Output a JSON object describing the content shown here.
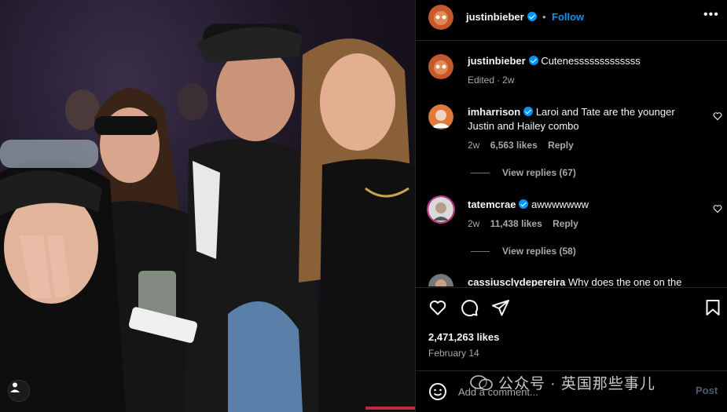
{
  "post": {
    "author": "justinbieber",
    "follow_label": "Follow",
    "header_separator": "•",
    "more_label": "•••",
    "caption": {
      "username": "justinbieber",
      "text": "Cutenesssssssssssss",
      "edited_label": "Edited",
      "time": "2w"
    },
    "comments": [
      {
        "username": "imharrison",
        "verified": true,
        "text": "Laroi and Tate are the younger Justin and Hailey combo",
        "time": "2w",
        "likes": "6,563 likes",
        "reply_label": "Reply",
        "view_replies": "View replies (67)"
      },
      {
        "username": "tatemcrae",
        "verified": true,
        "text": "awwwwwww",
        "time": "2w",
        "likes": "11,438 likes",
        "reply_label": "Reply",
        "view_replies": "View replies (58)"
      },
      {
        "username": "cassiusclydepereira",
        "verified": false,
        "text": "Why does the one on the"
      }
    ],
    "like_count": "2,471,263 likes",
    "date": "February 14",
    "add_comment_placeholder": "Add a comment...",
    "post_label": "Post"
  },
  "watermark": {
    "text": "公众号 · 英国那些事儿"
  },
  "icons": {
    "header_avatar": "avatar-icon",
    "like": "heart-icon",
    "comment": "comment-icon",
    "share": "share-icon",
    "save": "bookmark-icon",
    "emoji": "smiley-icon",
    "tag": "user-tag-icon",
    "more": "more-icon"
  },
  "colors": {
    "accent": "#0095f6",
    "background": "#000000",
    "secondary_text": "#a8a8a8",
    "divider": "#262626"
  }
}
